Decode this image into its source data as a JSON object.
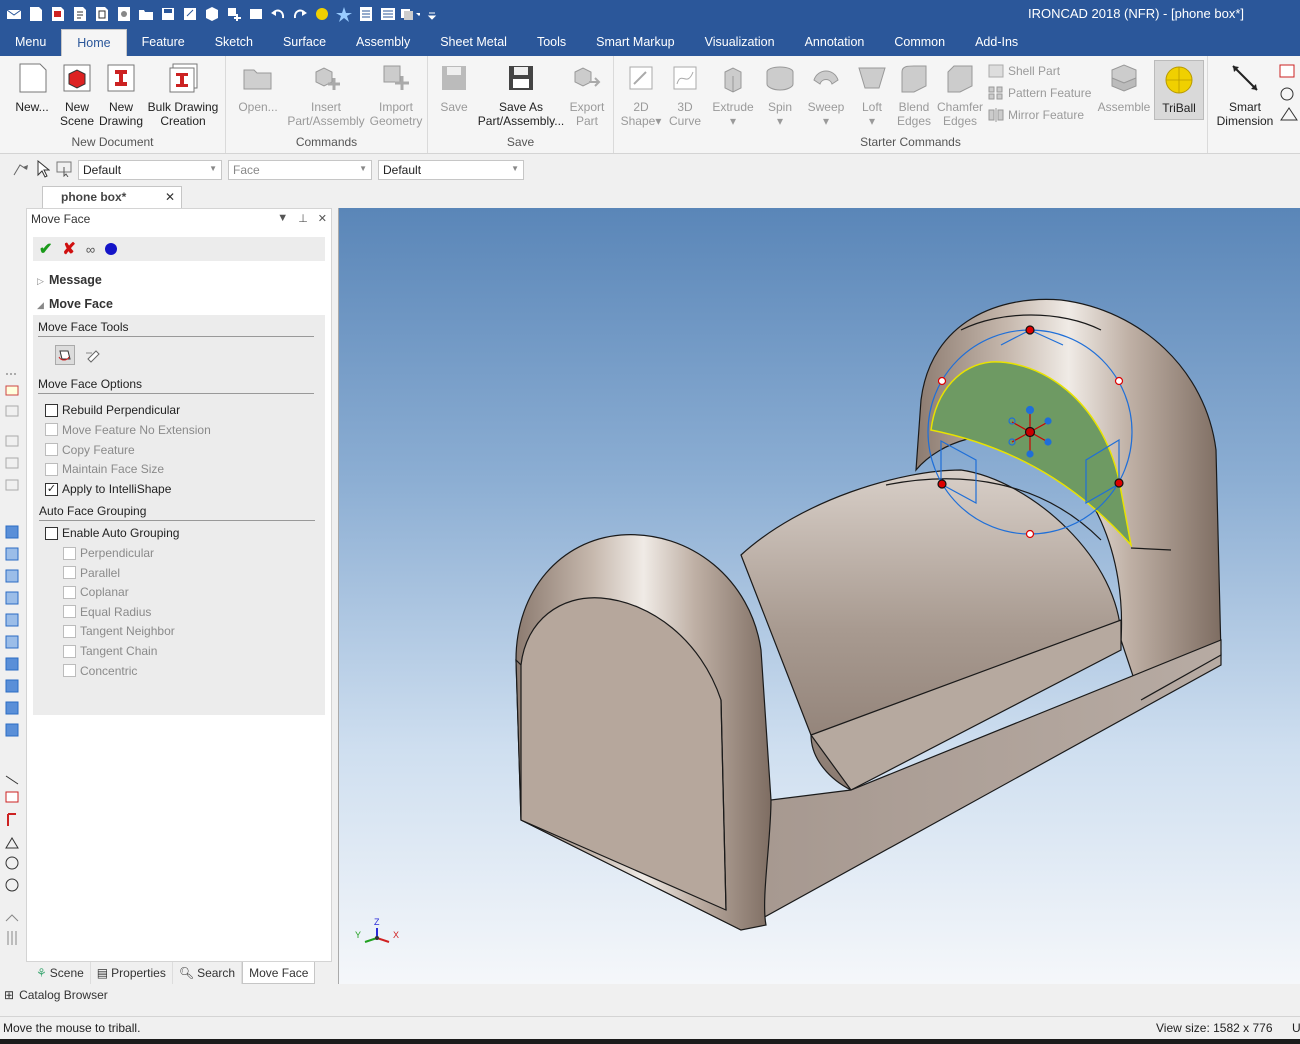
{
  "app": {
    "title": "IRONCAD 2018 (NFR) - [phone box*]"
  },
  "menu": {
    "tabs": [
      "Menu",
      "Home",
      "Feature",
      "Sketch",
      "Surface",
      "Assembly",
      "Sheet Metal",
      "Tools",
      "Smart Markup",
      "Visualization",
      "Annotation",
      "Common",
      "Add-Ins"
    ],
    "active": "Home"
  },
  "ribbon": {
    "groups": {
      "new_document": "New Document",
      "commands": "Commands",
      "save": "Save",
      "starter": "Starter Commands"
    },
    "new_scene": {
      "l1": "New",
      "l2": "Scene"
    },
    "new_menu": "New...",
    "new_drawing": {
      "l1": "New",
      "l2": "Drawing"
    },
    "bulk": {
      "l1": "Bulk Drawing",
      "l2": "Creation"
    },
    "open": "Open...",
    "insert": {
      "l1": "Insert",
      "l2": "Part/Assembly"
    },
    "import": {
      "l1": "Import",
      "l2": "Geometry"
    },
    "save": "Save",
    "save_as": {
      "l1": "Save As",
      "l2": "Part/Assembly..."
    },
    "export": {
      "l1": "Export",
      "l2": "Part"
    },
    "shape2d": {
      "l1": "2D",
      "l2": "Shape"
    },
    "curve3d": {
      "l1": "3D",
      "l2": "Curve"
    },
    "extrude": "Extrude",
    "spin": "Spin",
    "sweep": "Sweep",
    "loft": "Loft",
    "blend": {
      "l1": "Blend",
      "l2": "Edges"
    },
    "chamfer": {
      "l1": "Chamfer",
      "l2": "Edges"
    },
    "shell": "Shell Part",
    "pattern": "Pattern Feature",
    "mirror": "Mirror Feature",
    "assemble": "Assemble",
    "triball": "TriBall",
    "smartdim": {
      "l1": "Smart",
      "l2": "Dimension"
    }
  },
  "toolbar2": {
    "combo1": "Default",
    "combo2": "Face",
    "combo3": "Default"
  },
  "doc_tab": "phone box*",
  "panel": {
    "title": "Move Face",
    "message": "Message",
    "move_face": "Move Face",
    "tools_header": "Move Face Tools",
    "options_header": "Move Face Options",
    "options": [
      {
        "label": "Rebuild Perpendicular",
        "checked": false,
        "enabled": true
      },
      {
        "label": "Move Feature No Extension",
        "checked": false,
        "enabled": false
      },
      {
        "label": "Copy Feature",
        "checked": false,
        "enabled": false
      },
      {
        "label": "Maintain Face Size",
        "checked": false,
        "enabled": false
      },
      {
        "label": "Apply to IntelliShape",
        "checked": true,
        "enabled": true
      }
    ],
    "grouping_header": "Auto Face Grouping",
    "enable_auto": "Enable Auto Grouping",
    "groups": [
      "Perpendicular",
      "Parallel",
      "Coplanar",
      "Equal Radius",
      "Tangent Neighbor",
      "Tangent Chain",
      "Concentric"
    ]
  },
  "bottom_tabs": [
    "Scene",
    "Properties",
    "Search",
    "Move Face"
  ],
  "catalog": "Catalog Browser",
  "status": {
    "message": "Move the mouse to triball.",
    "view_size": "View size: 1582 x  776",
    "right": "U"
  },
  "axes": {
    "x": "X",
    "y": "Y",
    "z": "Z"
  },
  "colors": {
    "accent": "#2b579a",
    "selected_face": "#6e9a63",
    "triball": "#f0d000"
  }
}
